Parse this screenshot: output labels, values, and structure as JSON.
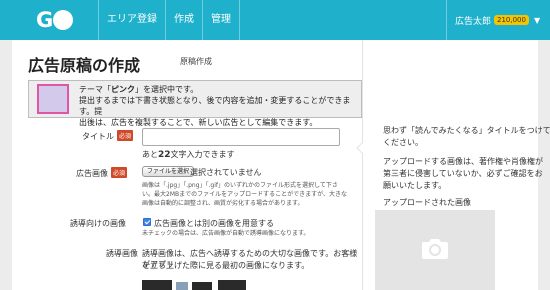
{
  "header": {
    "logo_text": "G",
    "nav": [
      "エリア登録",
      "作成",
      "管理"
    ],
    "user_name": "広告太郎",
    "points": "210,000",
    "brand_color": "#1fb1cc"
  },
  "page": {
    "title": "広告原稿の作成",
    "subtitle": "原稿作成"
  },
  "notice": {
    "line1_pre": "テーマ「",
    "line1_theme": "ピンク",
    "line1_post": "」を選択中です。",
    "line2": "提出するまでは下書き状態となり、後で内容を追加・変更することができます。提",
    "line3": "出後は、広告を複製することで、新しい広告として編集できます。"
  },
  "form": {
    "required_badge": "必須",
    "title_label": "タイトル",
    "title_value": "",
    "title_hint_pre": "あと",
    "title_hint_num": "22",
    "title_hint_post": "文字入力できます",
    "image_label": "広告画像",
    "file_button": "ファイルを選択",
    "file_status": "選択されていません",
    "image_note1": "画像は「.jpg」「.png」「.gif」のいずれかのファイル形式を選択して下さ",
    "image_note2": "い。最大2MBまでのファイルをアップロードすることができますが、大きな",
    "image_note3": "画像は自動的に調整され、画質が劣化する場合があります。",
    "lure_label": "誘導向けの画像",
    "lure_checkbox_label": "広告画像とは別の画像を用意する",
    "lure_note": "未チェックの場合は、広告画像が自動で誘導画像になります。",
    "lure_image_label": "誘導画像",
    "lure_desc1": "誘導画像は、広告へ誘導するための大切な画像です。お客様がアプリ",
    "lure_desc2": "を立ち上げた際に見る最初の画像になります。"
  },
  "sidebar": {
    "tip1_line1": "思わず「読んでみたくなる」タイトルをつけて",
    "tip1_line2": "ください。",
    "tip2_line1": "アップロードする画像は、著作権や肖像権が",
    "tip2_line2": "第三者に侵害していないか、必ずご確認をお",
    "tip2_line3": "願いいたします。",
    "uploaded_label": "アップロードされた画像",
    "preview_icon": "camera-icon"
  }
}
